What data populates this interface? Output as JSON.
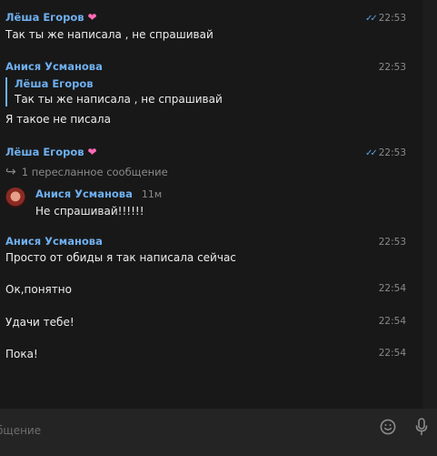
{
  "messages": [
    {
      "author": "Лёша Егоров",
      "heart": "❤",
      "text": "Так ты же написала , не спрашивай",
      "time": "22:53",
      "read": true
    },
    {
      "author": "Анися Усманова",
      "reply": {
        "author": "Лёша Егоров",
        "text": "Так ты же написала , не спрашивай"
      },
      "text": "Я такое не писала",
      "time": "22:53"
    },
    {
      "author": "Лёша Егоров",
      "heart": "❤",
      "forward_header": "1 пересланное сообщение",
      "forwarded": {
        "author": "Анися Усманова",
        "time": "11м",
        "text": "Не спрашивай!!!!!!"
      },
      "time": "22:53",
      "read": true
    },
    {
      "author": "Анися Усманова",
      "text": "Просто от обиды я так написала сейчас",
      "time": "22:53"
    },
    {
      "text": "Ок,понятно",
      "time": "22:54"
    },
    {
      "text": "Удачи тебе!",
      "time": "22:54"
    },
    {
      "text": "Пока!",
      "time": "22:54"
    }
  ],
  "composer": {
    "placeholder": "бщение"
  },
  "icons": {
    "read": "double-check-icon",
    "forward": "forward-arrow-icon",
    "emoji": "emoji-icon",
    "mic": "microphone-icon"
  },
  "colors": {
    "accent": "#6fb0f0",
    "heart": "#ff6bb5",
    "background": "#181818",
    "composer": "#242424"
  }
}
